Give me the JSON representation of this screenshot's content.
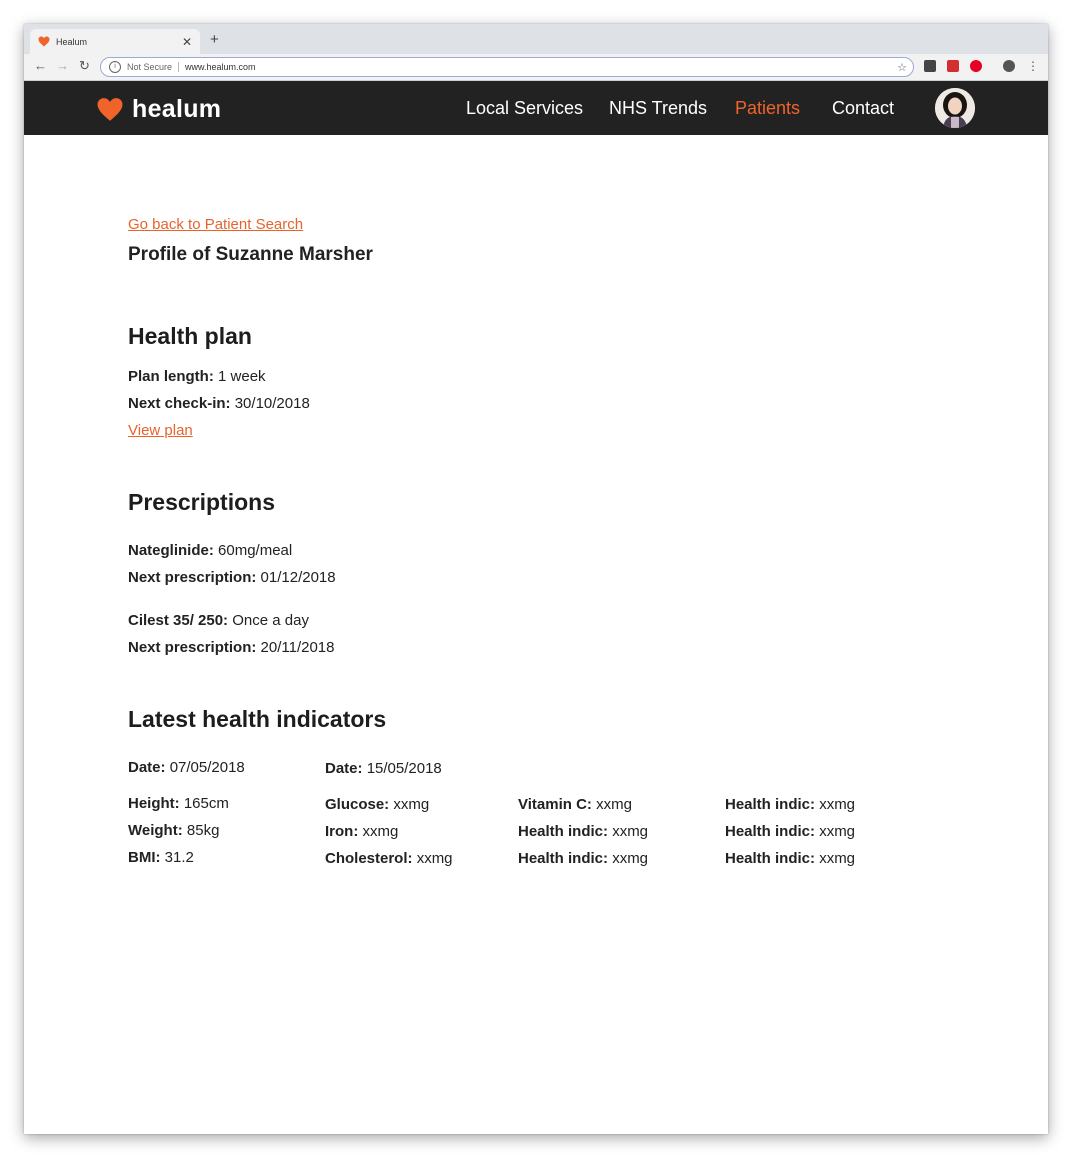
{
  "browser": {
    "tab_title": "Healum",
    "new_tab_symbol": "+",
    "security_label": "Not Secure",
    "url": "www.healum.com"
  },
  "header": {
    "brand": "healum",
    "nav": [
      {
        "label": "Local Services",
        "active": false
      },
      {
        "label": "NHS Trends",
        "active": false
      },
      {
        "label": "Patients",
        "active": true
      },
      {
        "label": "Contact",
        "active": false
      }
    ],
    "accent_color": "#f0642a"
  },
  "page": {
    "back_link": "Go back to Patient Search",
    "profile_title": "Profile of Suzanne Marsher"
  },
  "health_plan": {
    "heading": "Health plan",
    "plan_length_label": "Plan length:",
    "plan_length_value": "1 week",
    "next_checkin_label": "Next check-in:",
    "next_checkin_value": "30/10/2018",
    "view_plan_link": "View plan"
  },
  "prescriptions": {
    "heading": "Prescriptions",
    "items": [
      {
        "name_label": "Nateglinide:",
        "dose": "60mg/meal",
        "next_label": "Next prescription:",
        "next_value": "01/12/2018"
      },
      {
        "name_label": "Cilest 35/ 250:",
        "dose": "Once a day",
        "next_label": "Next prescription:",
        "next_value": "20/11/2018"
      }
    ]
  },
  "indicators": {
    "heading": "Latest health indicators",
    "columns": [
      {
        "date_label": "Date:",
        "date_value": "07/05/2018",
        "rows": [
          {
            "label": "Height:",
            "value": "165cm"
          },
          {
            "label": "Weight:",
            "value": "85kg"
          },
          {
            "label": "BMI:",
            "value": "31.2"
          }
        ]
      },
      {
        "date_label": "Date:",
        "date_value": "15/05/2018",
        "rows": [
          {
            "label": "Glucose:",
            "value": "xxmg"
          },
          {
            "label": "Iron:",
            "value": "xxmg"
          },
          {
            "label": "Cholesterol:",
            "value": "xxmg"
          }
        ]
      },
      {
        "rows": [
          {
            "label": "Vitamin C:",
            "value": "xxmg"
          },
          {
            "label": "Health indic:",
            "value": "xxmg"
          },
          {
            "label": "Health indic:",
            "value": "xxmg"
          }
        ]
      },
      {
        "rows": [
          {
            "label": "Health indic:",
            "value": "xxmg"
          },
          {
            "label": "Health indic:",
            "value": "xxmg"
          },
          {
            "label": "Health indic:",
            "value": "xxmg"
          }
        ]
      }
    ]
  }
}
